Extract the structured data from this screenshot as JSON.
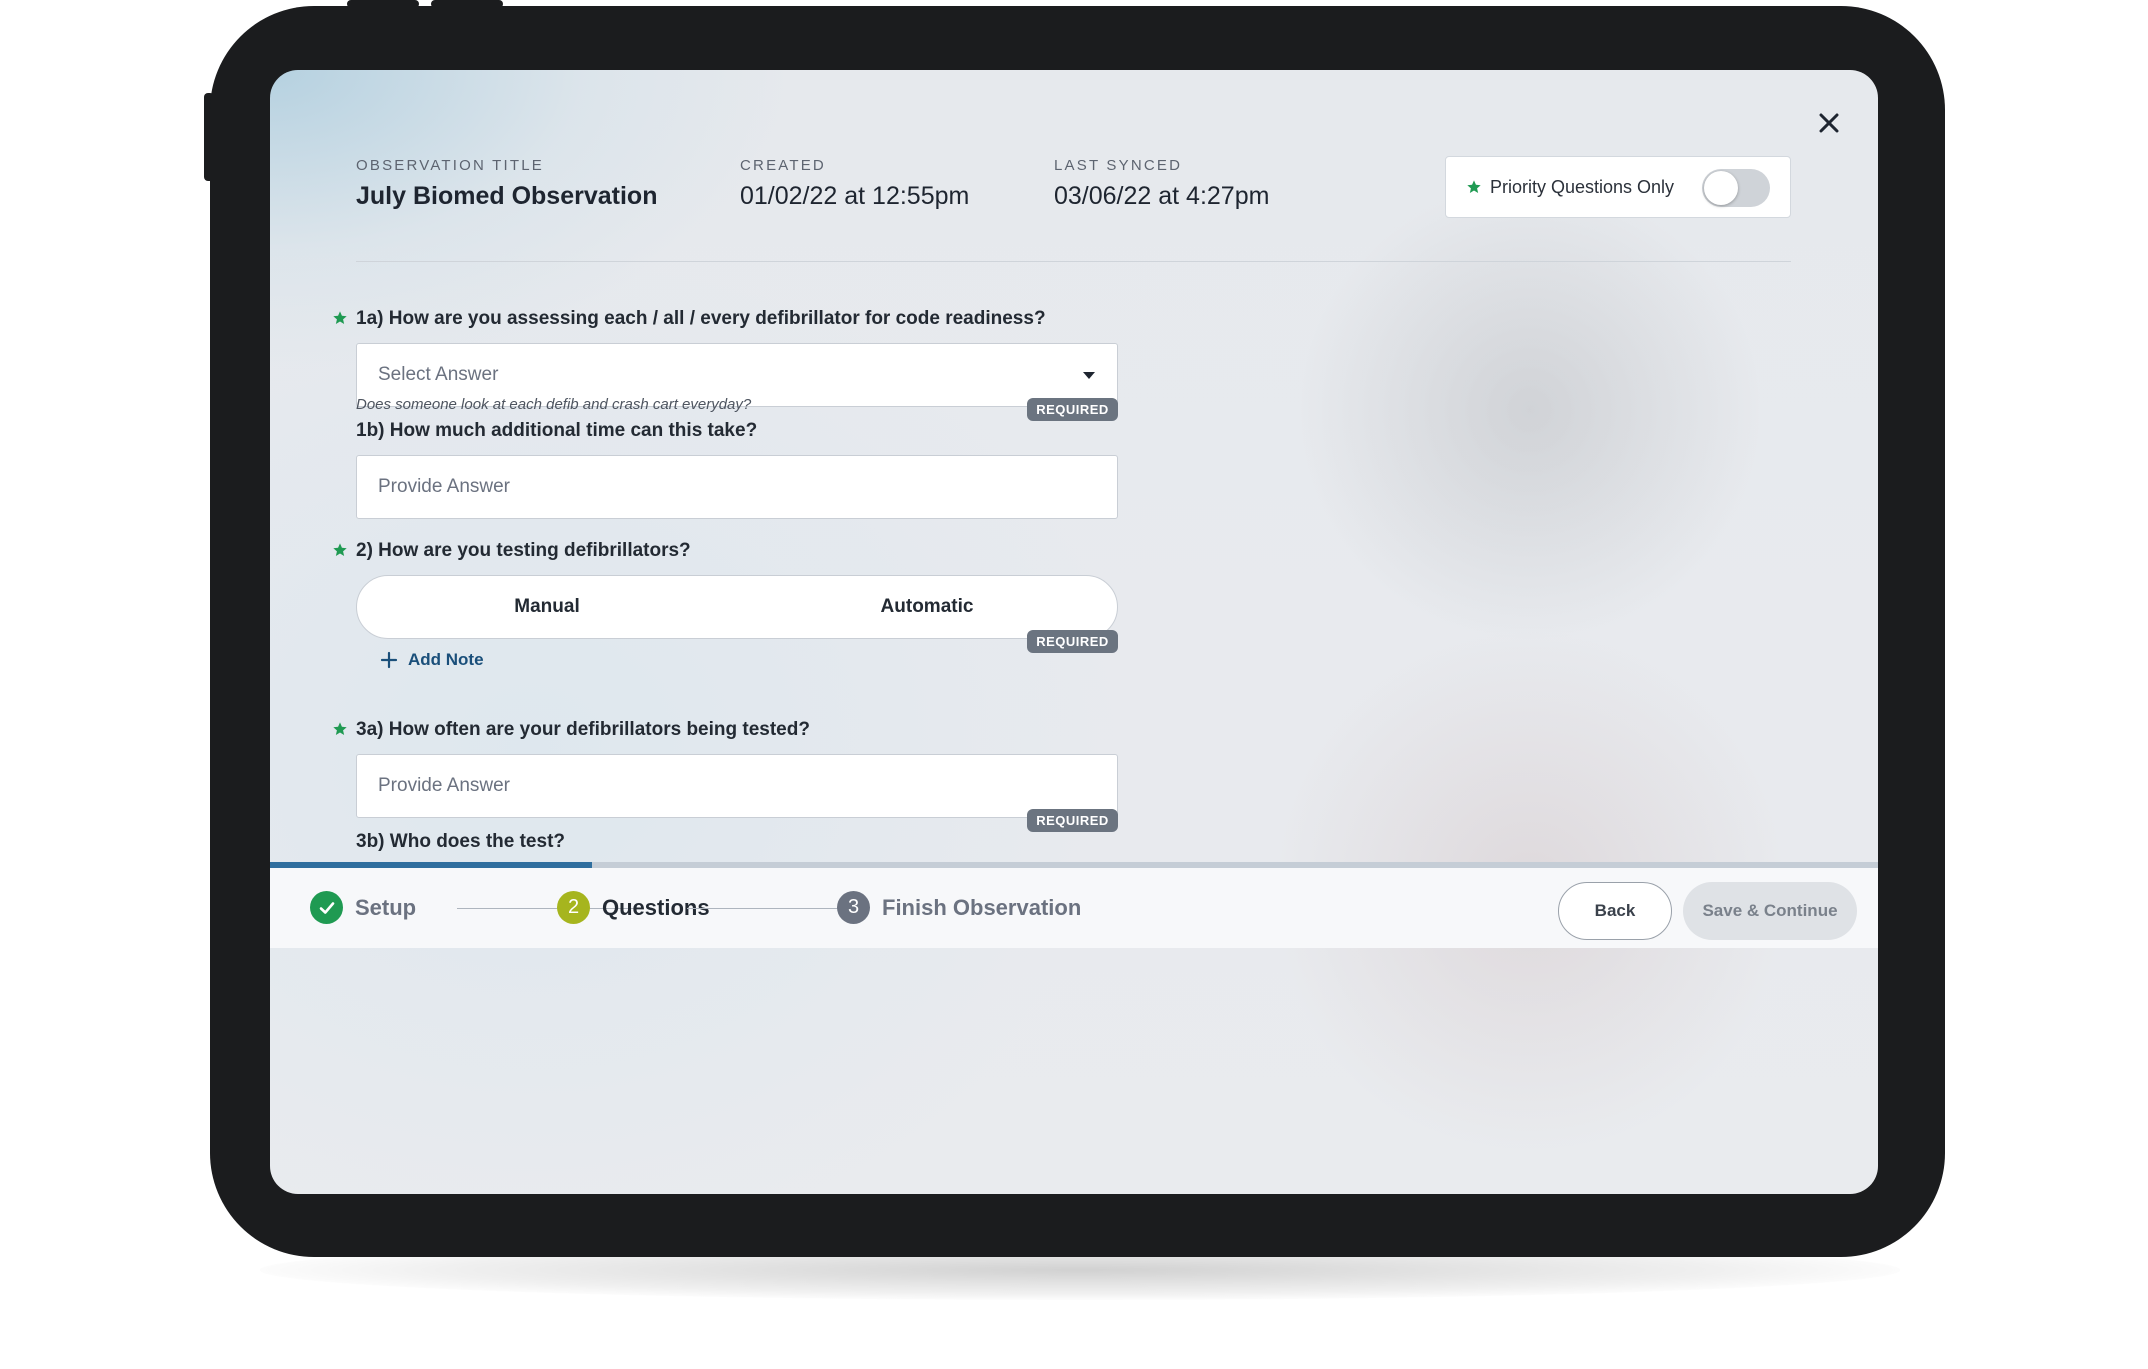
{
  "header": {
    "observation_title_label": "OBSERVATION TITLE",
    "observation_title": "July Biomed Observation",
    "created_label": "CREATED",
    "created_value": "01/02/22 at 12:55pm",
    "last_synced_label": "LAST SYNCED",
    "last_synced_value": "03/06/22 at 4:27pm",
    "priority_toggle_label": "Priority Questions Only",
    "priority_toggle_on": false
  },
  "questions": {
    "q1a": {
      "label": "1a) How are you assessing each / all / every defibrillator for code readiness?",
      "priority": true,
      "select_placeholder": "Select Answer",
      "hint": "Does someone look at each defib and crash cart everyday?",
      "badge": "REQUIRED"
    },
    "q1b": {
      "label": "1b) How much additional time can this take?",
      "placeholder": "Provide Answer"
    },
    "q2": {
      "label": "2) How are you testing defibrillators?",
      "priority": true,
      "options": [
        "Manual",
        "Automatic"
      ],
      "badge": "REQUIRED",
      "add_note_label": "Add Note"
    },
    "q3a": {
      "label": "3a) How often are your defibrillators being tested?",
      "priority": true,
      "placeholder": "Provide Answer",
      "badge": "REQUIRED"
    },
    "q3b": {
      "label": "3b) Who does the test?"
    }
  },
  "progress": {
    "fraction": 0.2
  },
  "steps": [
    {
      "number": "✓",
      "label": "Setup",
      "state": "complete"
    },
    {
      "number": "2",
      "label": "Questions",
      "state": "active"
    },
    {
      "number": "3",
      "label": "Finish Observation",
      "state": "upcoming"
    }
  ],
  "footer": {
    "back_label": "Back",
    "save_label": "Save & Continue"
  },
  "colors": {
    "accent_green": "#1f9a52",
    "step_active": "#a6b51e",
    "step_upcoming": "#6b7280",
    "progress": "#2f6e9e",
    "link_blue": "#1a4f7a"
  }
}
